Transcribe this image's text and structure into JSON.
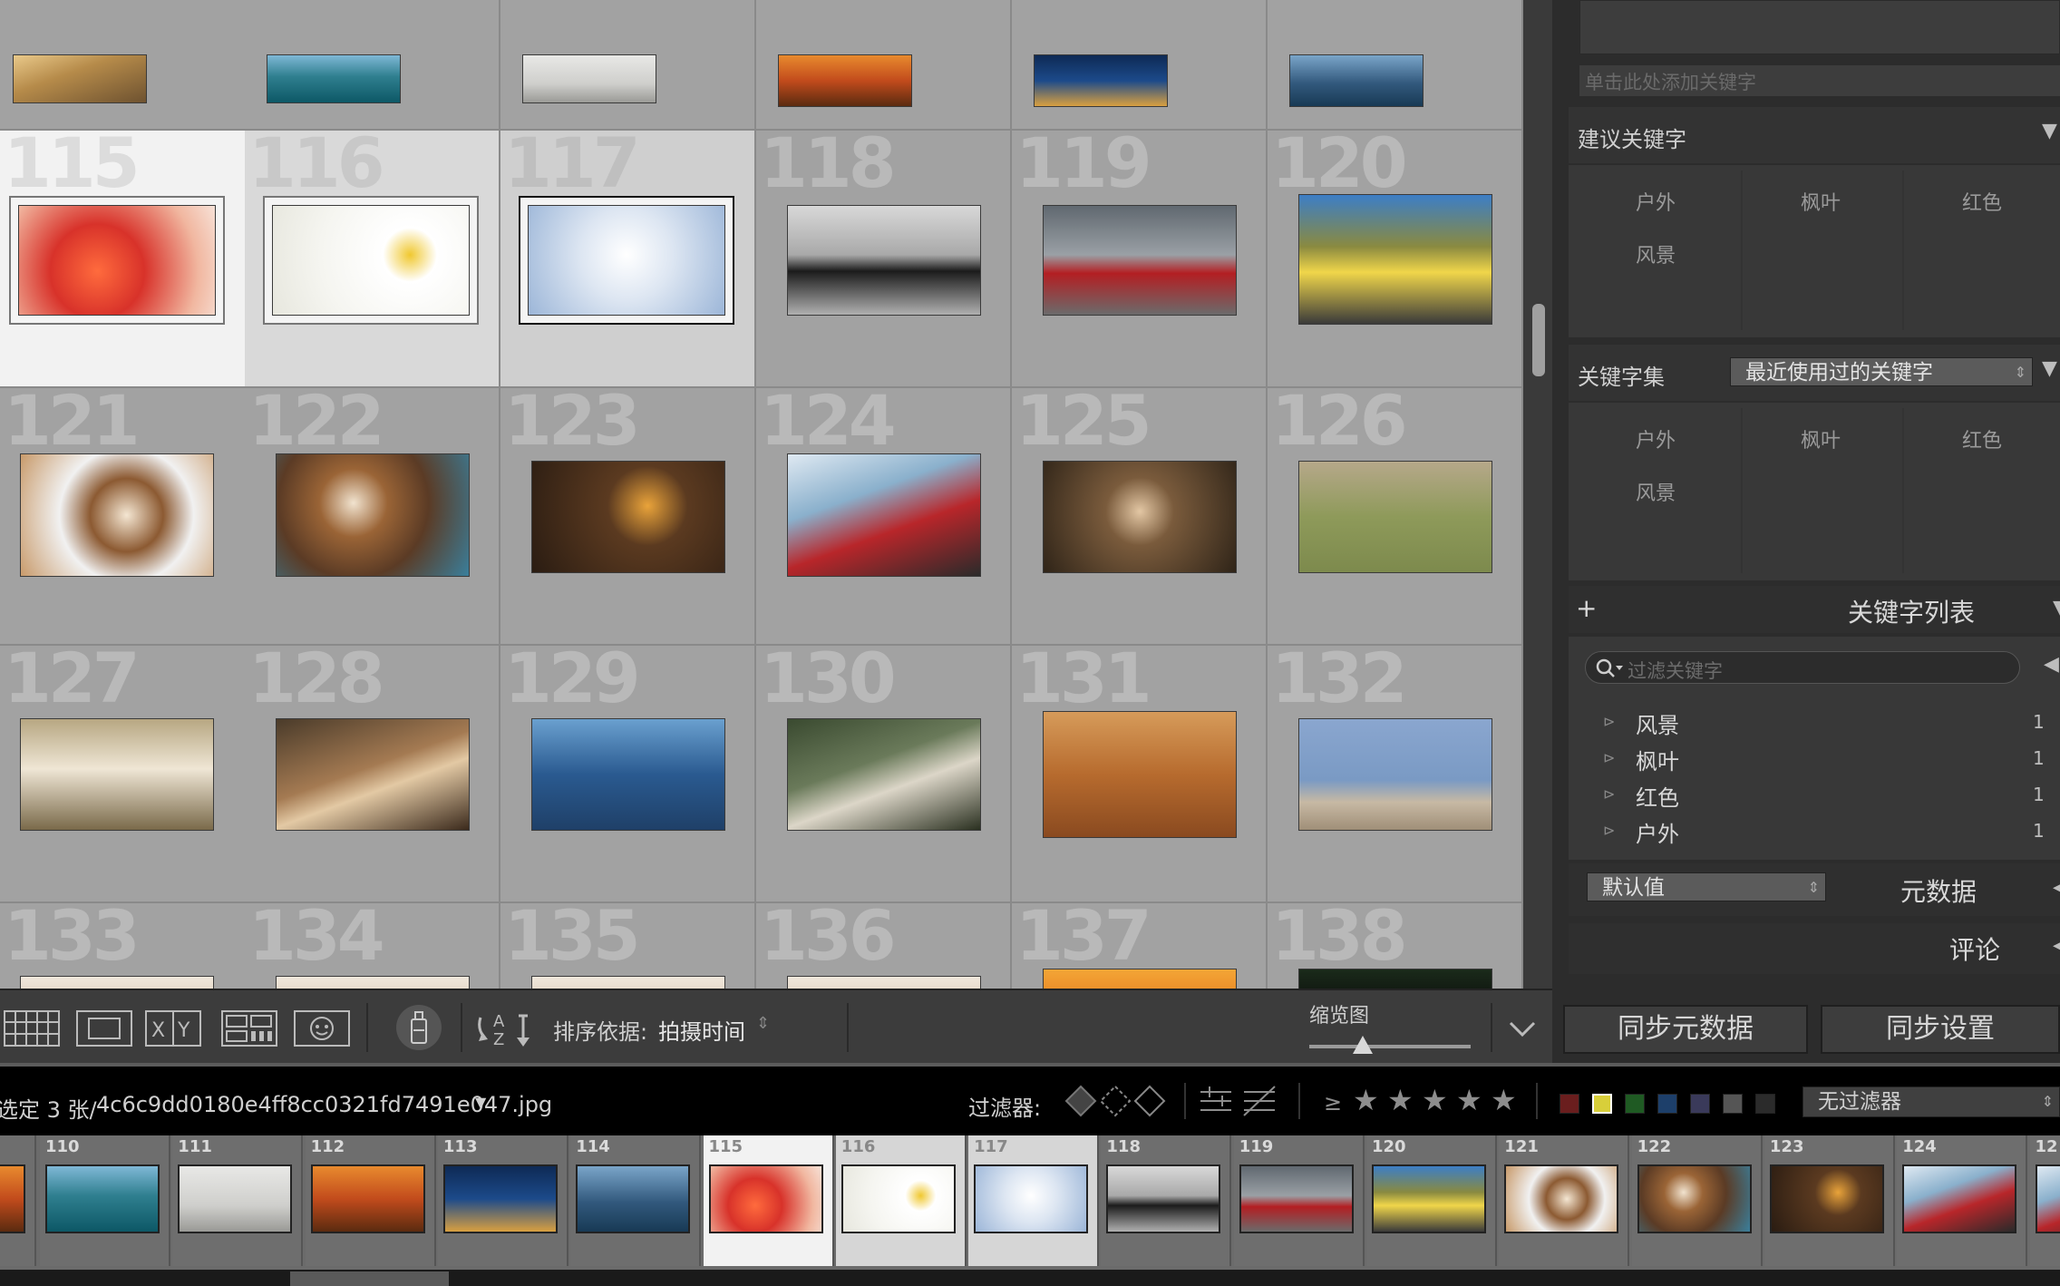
{
  "grid": {
    "rows": [
      {
        "numbers": [
          "",
          "",
          "",
          "",
          "",
          ""
        ]
      },
      {
        "numbers": [
          "115",
          "116",
          "117",
          "118",
          "119",
          "120"
        ]
      },
      {
        "numbers": [
          "121",
          "122",
          "123",
          "124",
          "125",
          "126"
        ]
      },
      {
        "numbers": [
          "127",
          "128",
          "129",
          "130",
          "131",
          "132"
        ]
      },
      {
        "numbers": [
          "133",
          "134",
          "135",
          "136",
          "137",
          "138"
        ]
      }
    ]
  },
  "right_panel": {
    "add_keyword_placeholder": "单击此处添加关键字",
    "suggested": {
      "title": "建议关键字",
      "keywords": [
        "户外",
        "枫叶",
        "红色",
        "风景"
      ]
    },
    "keyword_set": {
      "label": "关键字集",
      "selected": "最近使用过的关键字",
      "keywords": [
        "户外",
        "枫叶",
        "红色",
        "风景"
      ]
    },
    "keyword_list": {
      "add": "+",
      "title": "关键字列表",
      "filter_placeholder": "过滤关键字",
      "items": [
        {
          "name": "风景",
          "count": "1"
        },
        {
          "name": "枫叶",
          "count": "1"
        },
        {
          "name": "红色",
          "count": "1"
        },
        {
          "name": "户外",
          "count": "1"
        }
      ]
    },
    "metadata": {
      "preset": "默认值",
      "title": "元数据"
    },
    "comments": {
      "title": "评论"
    },
    "sync_metadata": "同步元数据",
    "sync_settings": "同步设置"
  },
  "toolbar": {
    "sort_label": "排序依据:",
    "sort_value": "拍摄时间",
    "thumb_label": "缩览图",
    "thumb_size": 0.33
  },
  "filter_bar": {
    "selection_text": "选定 3 张/",
    "filename": "4c6c9dd0180e4ff8cc0321fd7491e047.jpg",
    "filter_label": "过滤器:",
    "gte": "≥",
    "filter_preset": "无过滤器",
    "color_labels": [
      "#6a1e1e",
      "#d8cf3a",
      "#1f5a23",
      "#1d3f6a",
      "#3a3a5a",
      "#555555",
      "#2b2b2b"
    ]
  },
  "filmstrip": {
    "numbers": [
      "",
      "110",
      "111",
      "112",
      "113",
      "114",
      "115",
      "116",
      "117",
      "118",
      "119",
      "120",
      "121",
      "122",
      "123",
      "124",
      "12"
    ]
  },
  "icons": {
    "grid_view": "grid-view-icon",
    "loupe_view": "loupe-view-icon",
    "compare_view": "compare-view-icon",
    "survey_view": "survey-view-icon",
    "people_view": "people-view-icon",
    "spray": "painter-icon",
    "sort": "sort-order-icon"
  }
}
